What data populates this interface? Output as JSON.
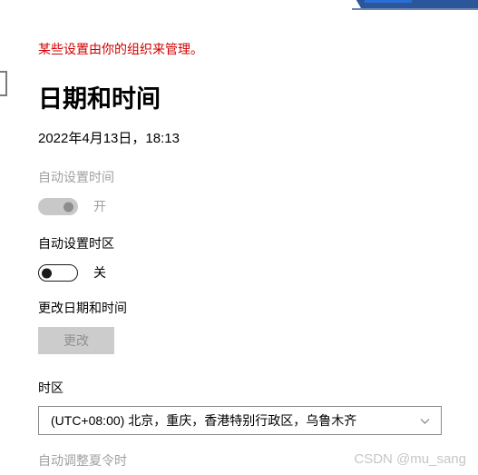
{
  "window_chrome": {
    "accent_color": "#2a6fd6",
    "bar_color": "#2b579a"
  },
  "notice": {
    "text": "某些设置由你的组织来管理。",
    "color": "#d00000"
  },
  "page": {
    "title": "日期和时间",
    "current_datetime": "2022年4月13日，18:13"
  },
  "settings": {
    "auto_time": {
      "label": "自动设置时间",
      "state_label": "开",
      "enabled": false,
      "on": true
    },
    "auto_timezone": {
      "label": "自动设置时区",
      "state_label": "关",
      "enabled": true,
      "on": false
    },
    "change_datetime": {
      "label": "更改日期和时间",
      "button_label": "更改",
      "button_enabled": false
    },
    "timezone": {
      "label": "时区",
      "selected": "(UTC+08:00) 北京，重庆，香港特别行政区，乌鲁木齐",
      "chevron_icon": "chevron-down-icon"
    },
    "dst": {
      "label": "自动调整夏令时",
      "enabled": false
    }
  },
  "watermark": {
    "text": "CSDN @mu_sang"
  }
}
